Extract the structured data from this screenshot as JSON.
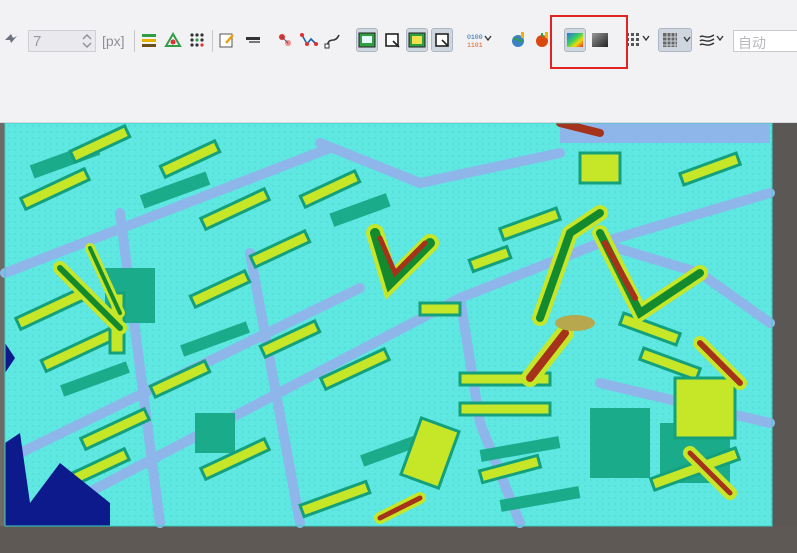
{
  "toolbar": {
    "brush_size": {
      "value": "7",
      "unit": "[px]"
    },
    "filter": {
      "placeholder": "自动"
    },
    "icons": [
      "pan-icon",
      "layer-stack-icon",
      "drawing-tool-icon",
      "dotted-grid-icon",
      "edit-note-icon",
      "line-tool-icon",
      "node-edit-icon",
      "polyline-icon",
      "curve-icon",
      "image-view-icon",
      "crop-icon",
      "composite-icon",
      "crop-outline-icon",
      "binary-value-icon",
      "globe-icon",
      "apple-icon",
      "color-ramp-icon",
      "grayscale-icon",
      "grid-dots-icon",
      "grid-matrix-icon",
      "wave-icon"
    ],
    "highlight_group": [
      "color-ramp-icon",
      "grayscale-icon"
    ]
  },
  "colors": {
    "highlight": "#e02424",
    "toolbar_bg": "#f2f2f5",
    "ramp_cyan": "#5fe7e2",
    "ramp_blue": "#8fb6ea",
    "ramp_teal": "#1aab8a",
    "ramp_yellow": "#c6e628",
    "ramp_green": "#138a2e",
    "ramp_red": "#a5331c",
    "ramp_navy": "#0c1a8c"
  },
  "map": {
    "layer": "classified-raster"
  }
}
